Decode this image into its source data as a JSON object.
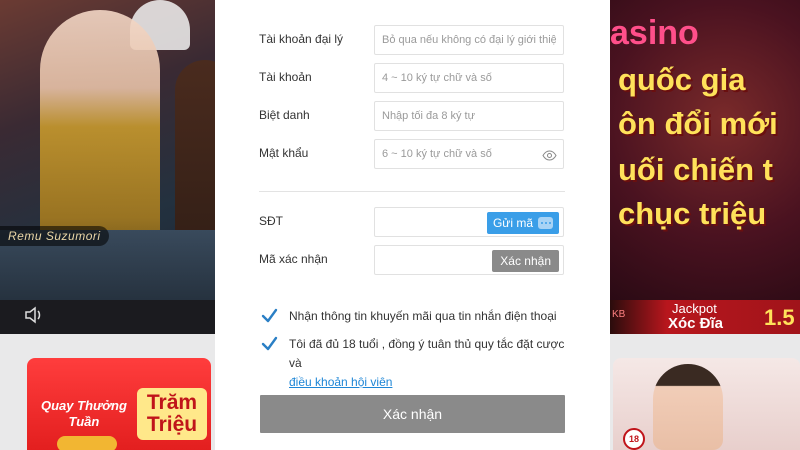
{
  "background": {
    "left_promo": {
      "name_tag": "Remu Suzumori"
    },
    "right_promo": {
      "casino": "asino",
      "lines": [
        "quốc gia",
        "ôn đổi mới",
        "uối chiến t",
        "chục triệu"
      ]
    },
    "jackpot": {
      "label": "Jackpot",
      "game": "Xóc Đĩa",
      "amount": "1.5",
      "side_text": "KB"
    },
    "card_left": {
      "line1": "Quay Thưởng",
      "line2": "Tuần",
      "badge1": "Trăm",
      "badge2": "Triệu"
    },
    "card_right": {
      "badge": "18"
    }
  },
  "form": {
    "agent": {
      "label": "Tài khoản đại lý",
      "placeholder": "Bỏ qua nếu không có đại lý giới thiệu"
    },
    "account": {
      "label": "Tài khoản",
      "placeholder": "4 ~ 10 ký tự chữ và số"
    },
    "nickname": {
      "label": "Biệt danh",
      "placeholder": "Nhập tối đa 8 ký tự"
    },
    "password": {
      "label": "Mật khẩu",
      "placeholder": "6 ~ 10 ký tự chữ và số"
    },
    "phone": {
      "label": "SĐT",
      "placeholder": "",
      "send_label": "Gửi mã"
    },
    "code": {
      "label": "Mã xác nhận",
      "placeholder": "",
      "verify_label": "Xác nhận"
    },
    "promo_check": {
      "text": "Nhận thông tin khuyến mãi qua tin nhắn điện thoại",
      "checked": true
    },
    "terms_check": {
      "text": "Tôi đã đủ 18 tuổi , đồng ý tuân thủ quy tắc đặt cược và",
      "link": "điều khoản hội viên",
      "checked": true
    },
    "submit_label": "Xác nhận"
  },
  "colors": {
    "primary_blue": "#3a9ee8",
    "check_blue": "#2a7fc5",
    "button_gray": "#8a8a8a",
    "link": "#1e86d6"
  }
}
